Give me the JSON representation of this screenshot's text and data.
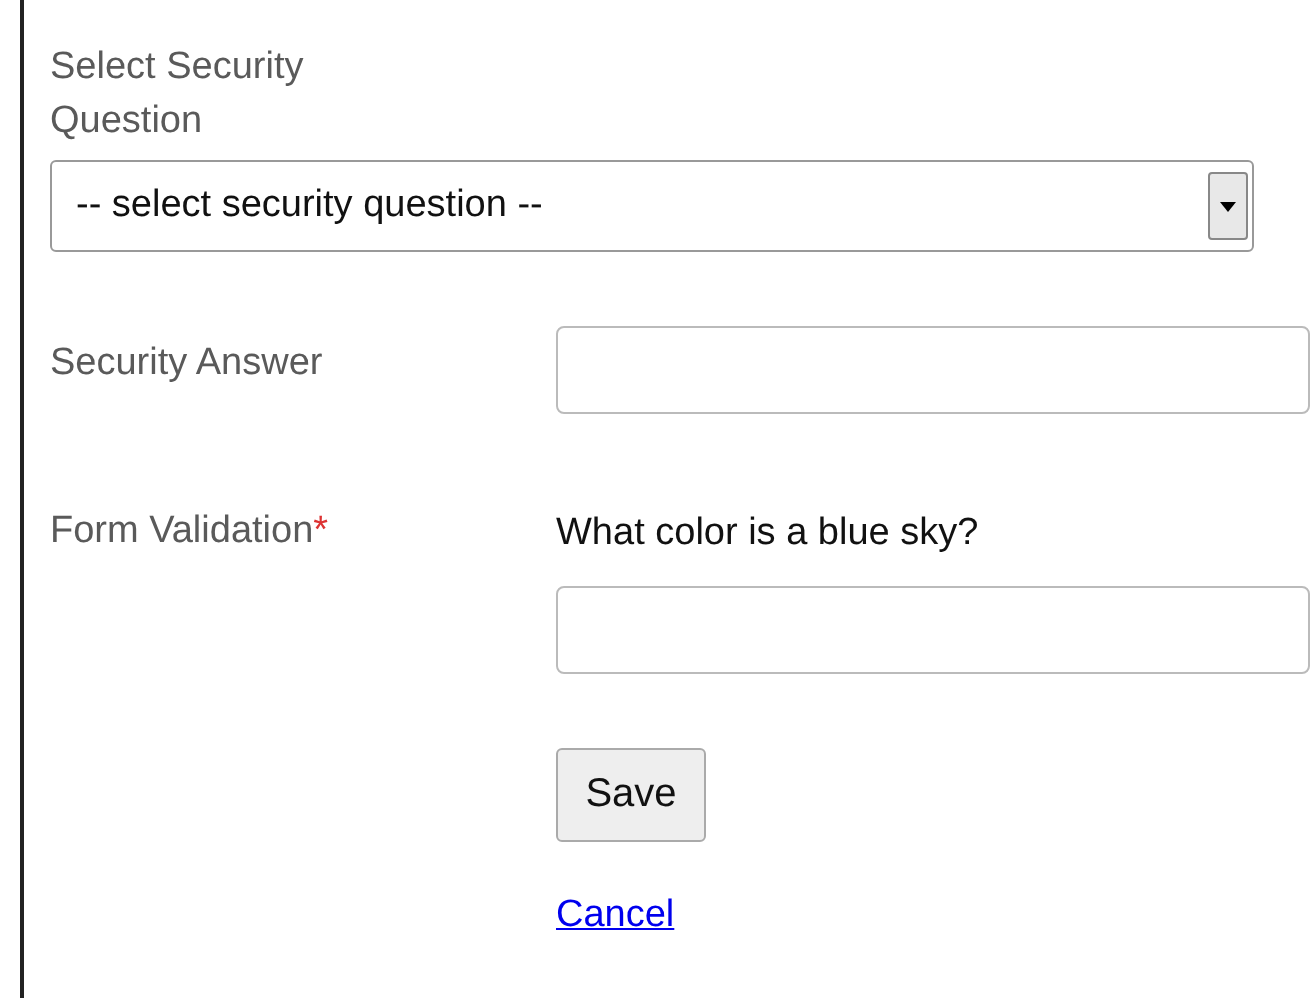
{
  "security_question": {
    "label": "Select Security Question",
    "value": "-- select security question --"
  },
  "security_answer": {
    "label": "Security Answer"
  },
  "form_validation": {
    "label": "Form Validation",
    "required_mark": "*",
    "question": "What color is a blue sky?"
  },
  "buttons": {
    "save": "Save",
    "cancel": "Cancel"
  }
}
